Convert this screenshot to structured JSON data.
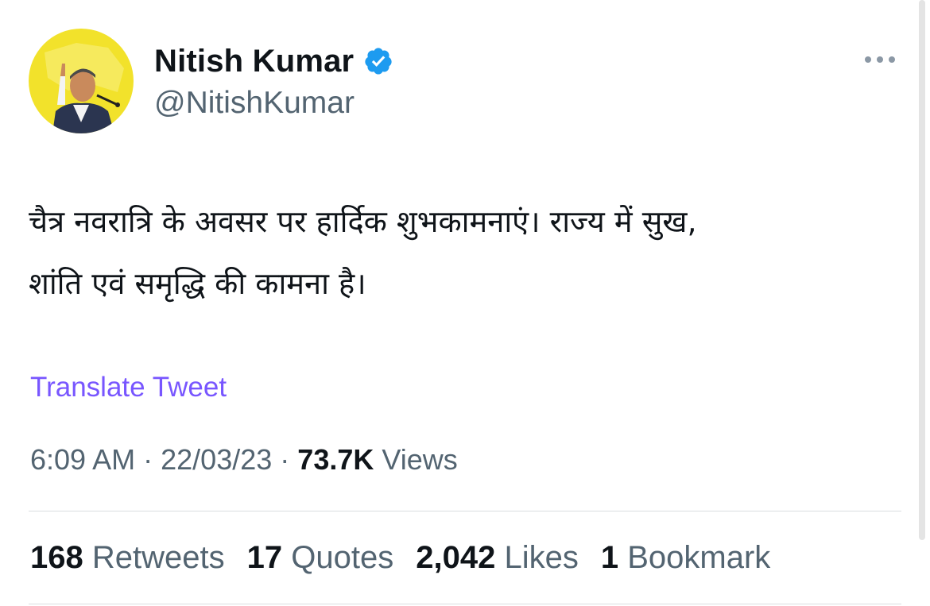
{
  "author": {
    "display_name": "Nitish Kumar",
    "handle": "@NitishKumar",
    "verified": true,
    "avatar_bg": "#f2e22b",
    "verified_color": "#1d9bf0"
  },
  "tweet": {
    "text": "चैत्र नवरात्रि के अवसर पर हार्दिक शुभकामनाएं। राज्य में सुख,\nशांति एवं समृद्धि की कामना है।",
    "translate_label": "Translate Tweet",
    "time": "6:09 AM",
    "separator": "·",
    "date": "22/03/23",
    "views_count": "73.7K",
    "views_label": "Views"
  },
  "stats": [
    {
      "count": "168",
      "label": "Retweets"
    },
    {
      "count": "17",
      "label": "Quotes"
    },
    {
      "count": "2,042",
      "label": "Likes"
    },
    {
      "count": "1",
      "label": "Bookmark"
    }
  ],
  "colors": {
    "text_primary": "#0f1419",
    "text_secondary": "#536471",
    "link": "#7856ff"
  }
}
